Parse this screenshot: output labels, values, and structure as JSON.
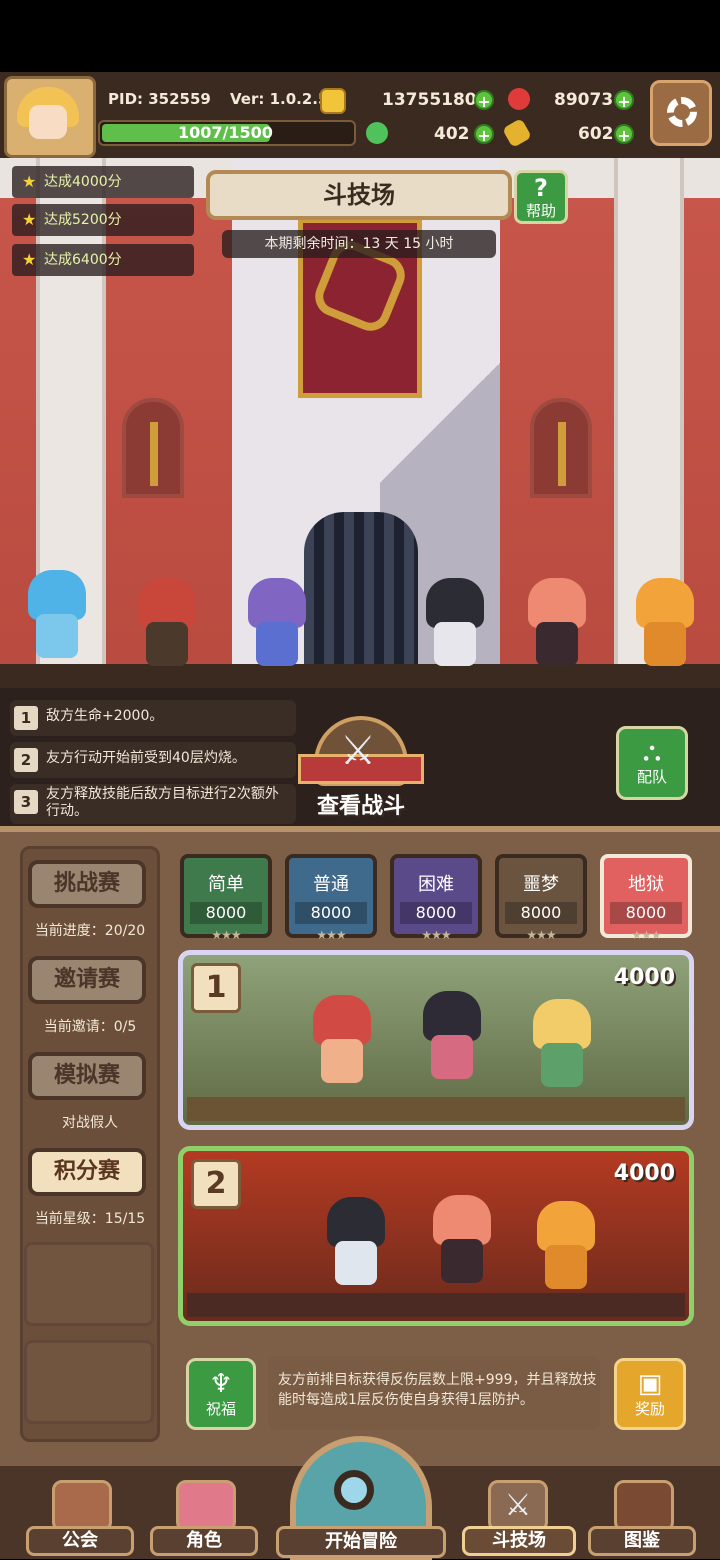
{
  "header": {
    "pid": "PID: 352559",
    "version": "Ver: 1.0.2.5",
    "gold": "13755180",
    "ruby": "89073",
    "clover": "402",
    "key": "602",
    "xp": "1007/1500",
    "xp_fraction": 0.671
  },
  "arena": {
    "title": "斗技场",
    "help_label": "帮助",
    "timer": "本期剩余时间：13 天 15 小时",
    "quests": [
      "达成4000分",
      "达成5200分",
      "达成6400分"
    ]
  },
  "rules": [
    {
      "num": "1",
      "text": "敌方生命+2000。"
    },
    {
      "num": "2",
      "text": "友方行动开始前受到40层灼烧。"
    },
    {
      "num": "3",
      "text": "友方释放技能后敌方目标进行2次额外行动。"
    }
  ],
  "view_battle_label": "查看战斗",
  "team_label": "配队",
  "tabs": [
    {
      "label": "挑战赛",
      "sub": "当前进度：20/20"
    },
    {
      "label": "邀请赛",
      "sub": "当前邀请：0/5"
    },
    {
      "label": "模拟赛",
      "sub": "对战假人"
    },
    {
      "label": "积分赛",
      "sub": "当前星级：15/15"
    }
  ],
  "difficulties": [
    {
      "name": "简单",
      "score": "8000",
      "color": "#3f7a4c"
    },
    {
      "name": "普通",
      "score": "8000",
      "color": "#3f6a8c"
    },
    {
      "name": "困难",
      "score": "8000",
      "color": "#5b4a8a"
    },
    {
      "name": "噩梦",
      "score": "8000",
      "color": "#6a5440"
    },
    {
      "name": "地狱",
      "score": "8000",
      "color": "#e0615f"
    }
  ],
  "matches": [
    {
      "num": "1",
      "points": "4000"
    },
    {
      "num": "2",
      "points": "4000"
    }
  ],
  "buff": {
    "blessing_label": "祝福",
    "text": "友方前排目标获得反伤层数上限+999，并且释放技能时每造成1层反伤使自身获得1层防护。",
    "reward_label": "奖励"
  },
  "nav": {
    "guild": "公会",
    "character": "角色",
    "adventure": "开始冒险",
    "arena": "斗技场",
    "codex": "图鉴"
  }
}
